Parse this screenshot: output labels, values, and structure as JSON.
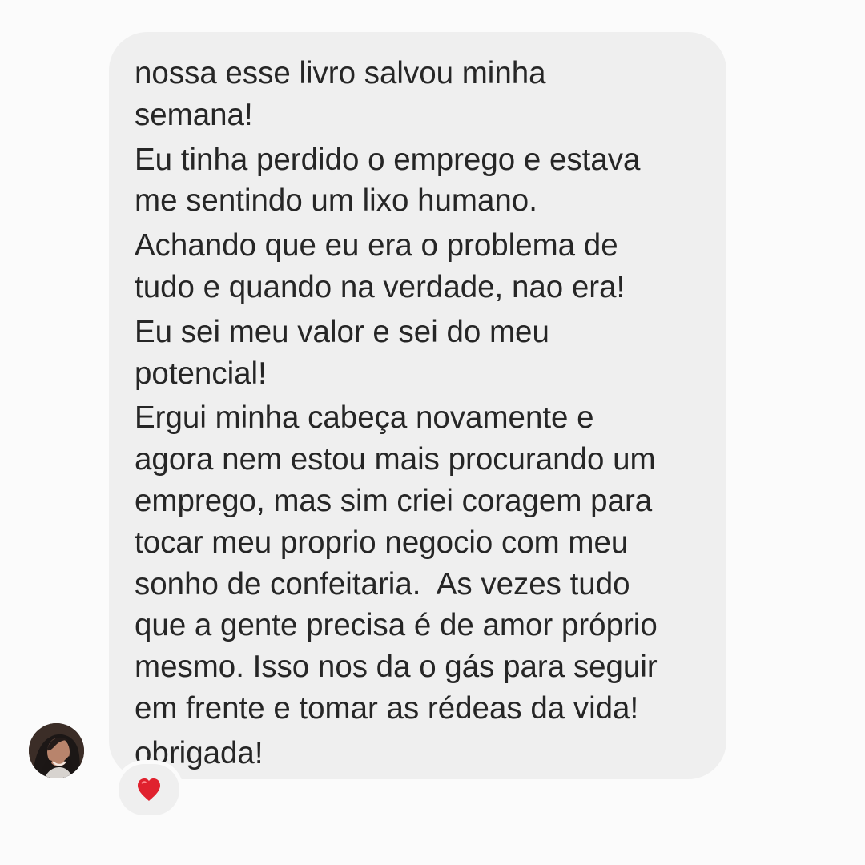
{
  "message": {
    "paragraphs": [
      "nossa esse livro salvou minha\nsemana!",
      "Eu tinha perdido o emprego e estava\nme sentindo um lixo humano.",
      "Achando que eu era o problema de\ntudo e quando na verdade, nao era!",
      "Eu sei meu valor e sei do meu\npotencial!",
      "Ergui minha cabeça novamente e\nagora nem estou mais procurando um\nemprego, mas sim criei coragem para\ntocar meu proprio negocio com meu\nsonho de confeitaria.  As vezes tudo\nque a gente precisa é de amor próprio\nmesmo. Isso nos da o gás para seguir\nem frente e tomar as rédeas da vida!",
      "obrigada!"
    ],
    "reaction": {
      "icon": "heart-icon",
      "color": "#e0212e"
    }
  },
  "sender": {
    "avatar_icon": "avatar-photo"
  },
  "colors": {
    "background": "#fbfbfb",
    "bubble": "#efefef",
    "text": "#262626"
  }
}
